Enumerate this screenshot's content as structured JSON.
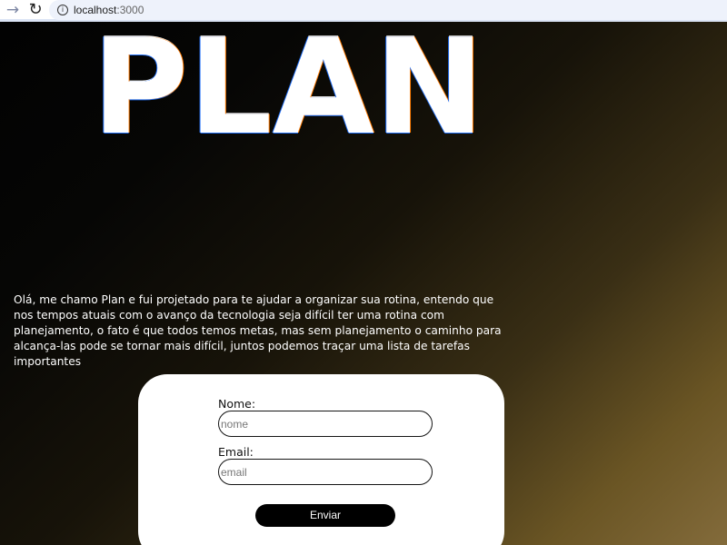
{
  "browser": {
    "back_icon": "→",
    "reload_icon": "↻",
    "info_icon": "i",
    "url_host": "localhost",
    "url_port": ":3000"
  },
  "hero": {
    "title": "PLAN"
  },
  "intro": {
    "text": "Olá, me chamo Plan e fui projetado para te ajudar a organizar sua rotina, entendo que nos tempos atuais com o avanço da tecnologia seja difícil ter uma rotina com planejamento, o fato é que todos temos metas, mas sem planejamento o caminho para alcança-las pode se tornar mais difícil, juntos podemos traçar uma lista de tarefas importantes"
  },
  "form": {
    "name_label": "Nome:",
    "name_placeholder": "nome",
    "email_label": "Email:",
    "email_placeholder": "email",
    "submit_label": "Enviar"
  },
  "colors": {
    "background_dark": "#020202",
    "background_gold": "#836b3b",
    "hero_text": "#ffffff",
    "form_background": "#ffffff",
    "button_background": "#000000",
    "button_text": "#ffffff"
  }
}
